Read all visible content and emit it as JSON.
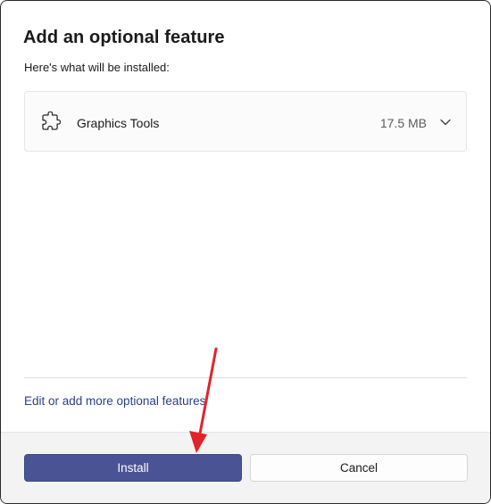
{
  "dialog": {
    "title": "Add an optional feature",
    "subtitle": "Here's what will be installed:"
  },
  "feature": {
    "icon": "puzzle-icon",
    "name": "Graphics Tools",
    "size": "17.5 MB",
    "expand_icon": "chevron-down-icon"
  },
  "links": {
    "more_features": "Edit or add more optional features"
  },
  "footer": {
    "install_label": "Install",
    "cancel_label": "Cancel"
  },
  "colors": {
    "accent": "#4a5494",
    "link": "#2b3f8a",
    "annotation": "#e0242a"
  }
}
